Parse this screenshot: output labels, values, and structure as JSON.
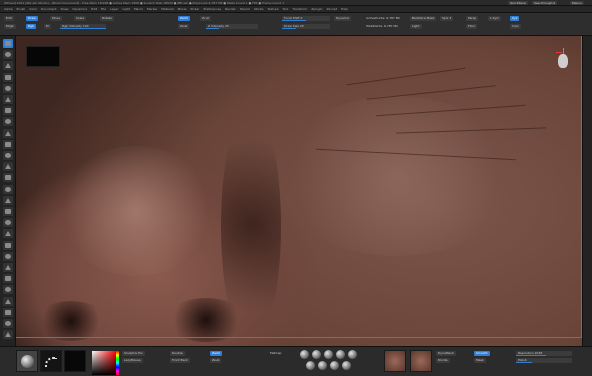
{
  "window": {
    "title": "[Wheel] 2021 [Zbrush Studio] - [Brush Document] - Free Mem 18.998 ● Active Mem 1958 ● Scratch Disk 18934 ● ZBrush ● PolyCount 6.787 MP ● Mesh Count 1 ● FPS ● Frame Count 1",
    "quicksave_label": "QuickSave",
    "see_through_label": "See-through 0",
    "menus_label": "Menus"
  },
  "menubar": {
    "items": [
      "Alpha",
      "Brush",
      "Color",
      "Document",
      "Draw",
      "Dynamics",
      "Edit",
      "File",
      "Layer",
      "Light",
      "Macro",
      "Marker",
      "Material",
      "Movie",
      "Picker",
      "Preferences",
      "Render",
      "Stencil",
      "Stroke",
      "Texture",
      "Tool",
      "Transform",
      "Zplugin",
      "Zscript",
      "Help"
    ]
  },
  "topbar": {
    "focal_shift": "Focal Shift 0",
    "draw_size": "Draw Size 29",
    "z_intensity": "Z Intensity 25",
    "rgb_intensity": "Rgb Intensity 100",
    "mrgb": "Mrgb",
    "rgb": "Rgb",
    "m": "M",
    "zadd": "Zadd",
    "zsub": "Zsub",
    "zcut": "Zcut",
    "edit": "Edit",
    "draw": "Draw",
    "move": "Move",
    "scale": "Scale",
    "rotate": "Rotate",
    "dynamic": "Dynamic",
    "active_points": "ActivePoints: 6.787 Mil",
    "total_points": "TotalPoints: 6.787 Mil",
    "backface_mask": "Backface Mask",
    "light": "Light",
    "spix": "Spix 3",
    "cam": "Cam",
    "persp": "Persp",
    "floor": "Floor",
    "lsym": "L.Sym",
    "xyz": "Xyz"
  },
  "bottombar": {
    "sculptris_pro": "Sculptris Pro",
    "lazy_mouse": "LazyMouse",
    "double": "Double",
    "front_back": "Front Back",
    "zadd": "Zadd",
    "zsub": "Zsub",
    "material_label": "MatCap",
    "dynamesh": "DynaMesh",
    "divide": "Divide",
    "smooth": "Smooth",
    "resolution": "Resolution 2048",
    "mask": "Mask",
    "polish": "Polish"
  },
  "colors": {
    "accent": "#2f7ed8",
    "frame": "#b85a3a"
  },
  "icons": {
    "tools": [
      "brush-icon",
      "move-icon",
      "scale-icon",
      "rotate-icon",
      "layer-icon",
      "material-icon",
      "texture-icon",
      "light-icon",
      "mask-icon",
      "symmetry-icon",
      "floor-icon",
      "frame-icon",
      "zoom-icon",
      "pan-icon",
      "persp-icon",
      "lsym-icon",
      "transp-icon",
      "solo-icon",
      "xpose-icon",
      "polyf-icon",
      "lasso-icon",
      "rotate-camera-icon",
      "local-icon",
      "grid-icon",
      "history-icon",
      "info-icon",
      "settings-icon"
    ]
  }
}
